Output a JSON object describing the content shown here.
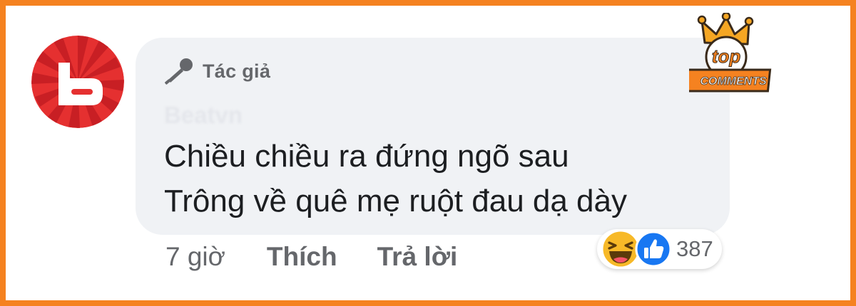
{
  "colors": {
    "frame": "#f58220",
    "bubble": "#f0f2f5",
    "avatar_red": "#e53030",
    "like_blue": "#1877f2",
    "haha_yellow": "#f7b928",
    "muted_text": "#65676b"
  },
  "comment": {
    "badge_icon": "microphone-icon",
    "badge_label": "Tác giả",
    "author_name": "Beatvn",
    "lines": [
      "Chiều chiều ra đứng ngõ sau",
      "Trông về quê mẹ ruột đau dạ dày"
    ]
  },
  "actions": {
    "time": "7 giờ",
    "like": "Thích",
    "reply": "Trả lời"
  },
  "reactions": {
    "icons": [
      "haha-icon",
      "like-icon"
    ],
    "count": "387"
  },
  "logo": {
    "line1": "top",
    "line2": "COMMENTS"
  }
}
